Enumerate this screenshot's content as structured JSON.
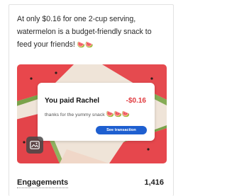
{
  "post": {
    "text": "At only $0.16 for one 2-cup serving, watermelon is a budget-friendly snack to feed your friends!",
    "text_emoji": "🍉🍉"
  },
  "payment_card": {
    "you_paid": "You paid",
    "recipient": "Rachel",
    "amount": "-$0.16",
    "note": "thanks for the yummy snack",
    "note_emoji": "🍉🍉🍉",
    "button_label": "See transaction"
  },
  "stats": {
    "engagements_label": "Engagements",
    "engagements_value": "1,416"
  },
  "colors": {
    "accent_blue": "#1e5fd0",
    "amount_red": "#e0393e",
    "watermelon_red": "#e8474c",
    "rind_green": "#7aa24a"
  },
  "icons": {
    "media_badge": "image-icon"
  }
}
